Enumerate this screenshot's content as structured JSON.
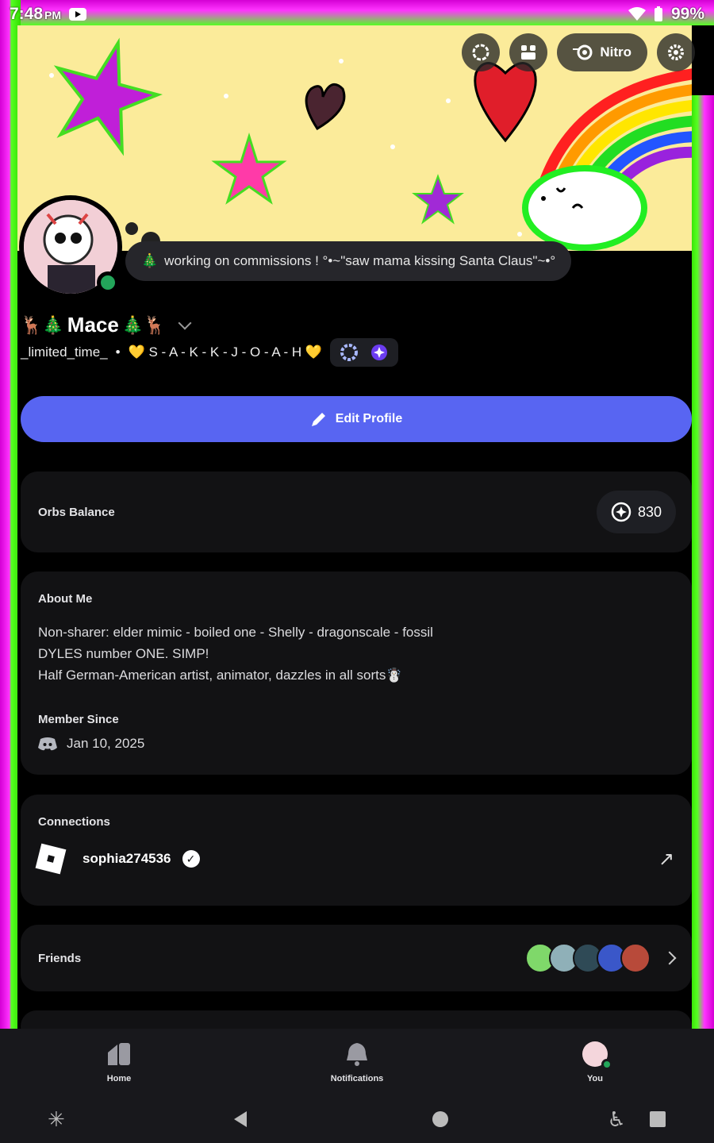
{
  "status_bar": {
    "time": "7:48",
    "ampm": "PM",
    "battery": "99%"
  },
  "top_actions": {
    "nitro_label": "Nitro"
  },
  "status_message": {
    "emoji": "🎄",
    "text": "working on commissions ! °•~\"saw mama kissing Santa Claus\"~•°"
  },
  "profile": {
    "display_name": "Mace",
    "name_prefix": "🦌🎄",
    "name_suffix": "🎄🦌",
    "username": "_limited_time_",
    "separator": "•",
    "pronouns": "💛 S - A - K - K - J - O - A - H 💛"
  },
  "edit_profile": {
    "label": "Edit Profile"
  },
  "orbs": {
    "title": "Orbs Balance",
    "value": "830"
  },
  "about": {
    "title": "About Me",
    "lines": [
      "Non-sharer: elder mimic - boiled one - Shelly - dragonscale - fossil",
      "DYLES number ONE. SIMP!",
      "Half German-American artist, animator, dazzles in all sorts☃️"
    ],
    "member_since_title": "Member Since",
    "member_since_date": "Jan 10, 2025"
  },
  "connections": {
    "title": "Connections",
    "account_name": "sophia274536"
  },
  "friends": {
    "title": "Friends"
  },
  "bottom_nav": {
    "home": "Home",
    "notifications": "Notifications",
    "you": "You"
  },
  "colors": {
    "blurple": "#5865f2",
    "online": "#23a55a",
    "banner": "#fbeb9a"
  }
}
